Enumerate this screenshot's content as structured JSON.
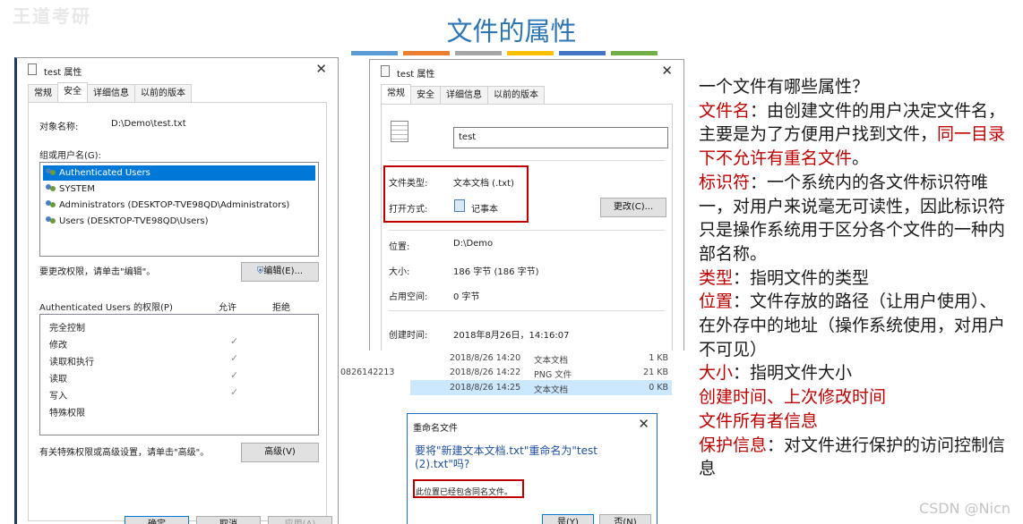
{
  "watermark": "王道考研",
  "slide_title": "文件的属性",
  "accent_colors": [
    "#5b9bd5",
    "#ed7d31",
    "#a5a5a5",
    "#ffc000",
    "#4472c4",
    "#70ad47"
  ],
  "security_dialog": {
    "title": "test 属性",
    "tabs": [
      "常规",
      "安全",
      "详细信息",
      "以前的版本"
    ],
    "object_name_label": "对象名称:",
    "object_name_value": "D:\\Demo\\test.txt",
    "group_label": "组或用户名(G):",
    "users": [
      "Authenticated Users",
      "SYSTEM",
      "Administrators (DESKTOP-TVE98QD\\Administrators)",
      "Users (DESKTOP-TVE98QD\\Users)"
    ],
    "change_hint": "要更改权限，请单击\"编辑\"。",
    "edit_button": "编辑(E)...",
    "perm_title": "Authenticated Users 的权限(P)",
    "allow_label": "允许",
    "deny_label": "拒绝",
    "permissions": [
      "完全控制",
      "修改",
      "读取和执行",
      "读取",
      "写入",
      "特殊权限"
    ],
    "advanced_hint": "有关特殊权限或高级设置，请单击\"高级\"。",
    "advanced_button": "高级(V)",
    "bottom_buttons": [
      "确定",
      "取消",
      "应用(A)"
    ]
  },
  "general_dialog": {
    "title": "test 属性",
    "tabs": [
      "常规",
      "安全",
      "详细信息",
      "以前的版本"
    ],
    "filename": "test",
    "type_label": "文件类型:",
    "type_value": "文本文档 (.txt)",
    "open_with_label": "打开方式:",
    "open_with_value": "记事本",
    "change_button": "更改(C)...",
    "location_label": "位置:",
    "location_value": "D:\\Demo",
    "size_label": "大小:",
    "size_value": "186 字节 (186 字节)",
    "disk_label": "占用空间:",
    "disk_value": "0 字节",
    "created_label": "创建时间:",
    "created_value": "2018年8月26日，14:16:07"
  },
  "file_rows": [
    {
      "name": "",
      "date": "2018/8/26 14:20",
      "type": "文本文档",
      "size": "1 KB"
    },
    {
      "name": "0826142213",
      "date": "2018/8/26 14:22",
      "type": "PNG 文件",
      "size": "21 KB"
    },
    {
      "name": "",
      "date": "2018/8/26 14:25",
      "type": "文本文档",
      "size": "0 KB"
    }
  ],
  "rename_dialog": {
    "title": "重命名文件",
    "question": "要将\"新建文本文档.txt\"重命名为\"test (2).txt\"吗?",
    "warning": "此位置已经包含同名文件。",
    "yes_button": "是(Y)",
    "no_button": "否(N)"
  },
  "explanation": {
    "intro": "一个文件有哪些属性？",
    "name_term": "文件名",
    "name_desc": "：由创建文件的用户决定文件名，主要是为了方便用户找到文件，",
    "name_rule": "同一目录下不允许有重名文件",
    "id_term": "标识符",
    "id_desc": "：一个系统内的各文件标识符唯一，对用户来说毫无可读性，因此标识符只是操作系统用于区分各个文件的一种内部名称。",
    "type_term": "类型",
    "type_desc": "：指明文件的类型",
    "loc_term": "位置",
    "loc_desc": "：文件存放的路径（让用户使用）、在外存中的地址（操作系统使用，对用户不可见）",
    "size_term": "大小",
    "size_desc": "：指明文件大小",
    "time_line": "创建时间、上次修改时间",
    "owner_line": "文件所有者信息",
    "prot_term": "保护信息",
    "prot_desc": "：对文件进行保护的访问控制信息"
  },
  "footer": "CSDN @Nicn"
}
